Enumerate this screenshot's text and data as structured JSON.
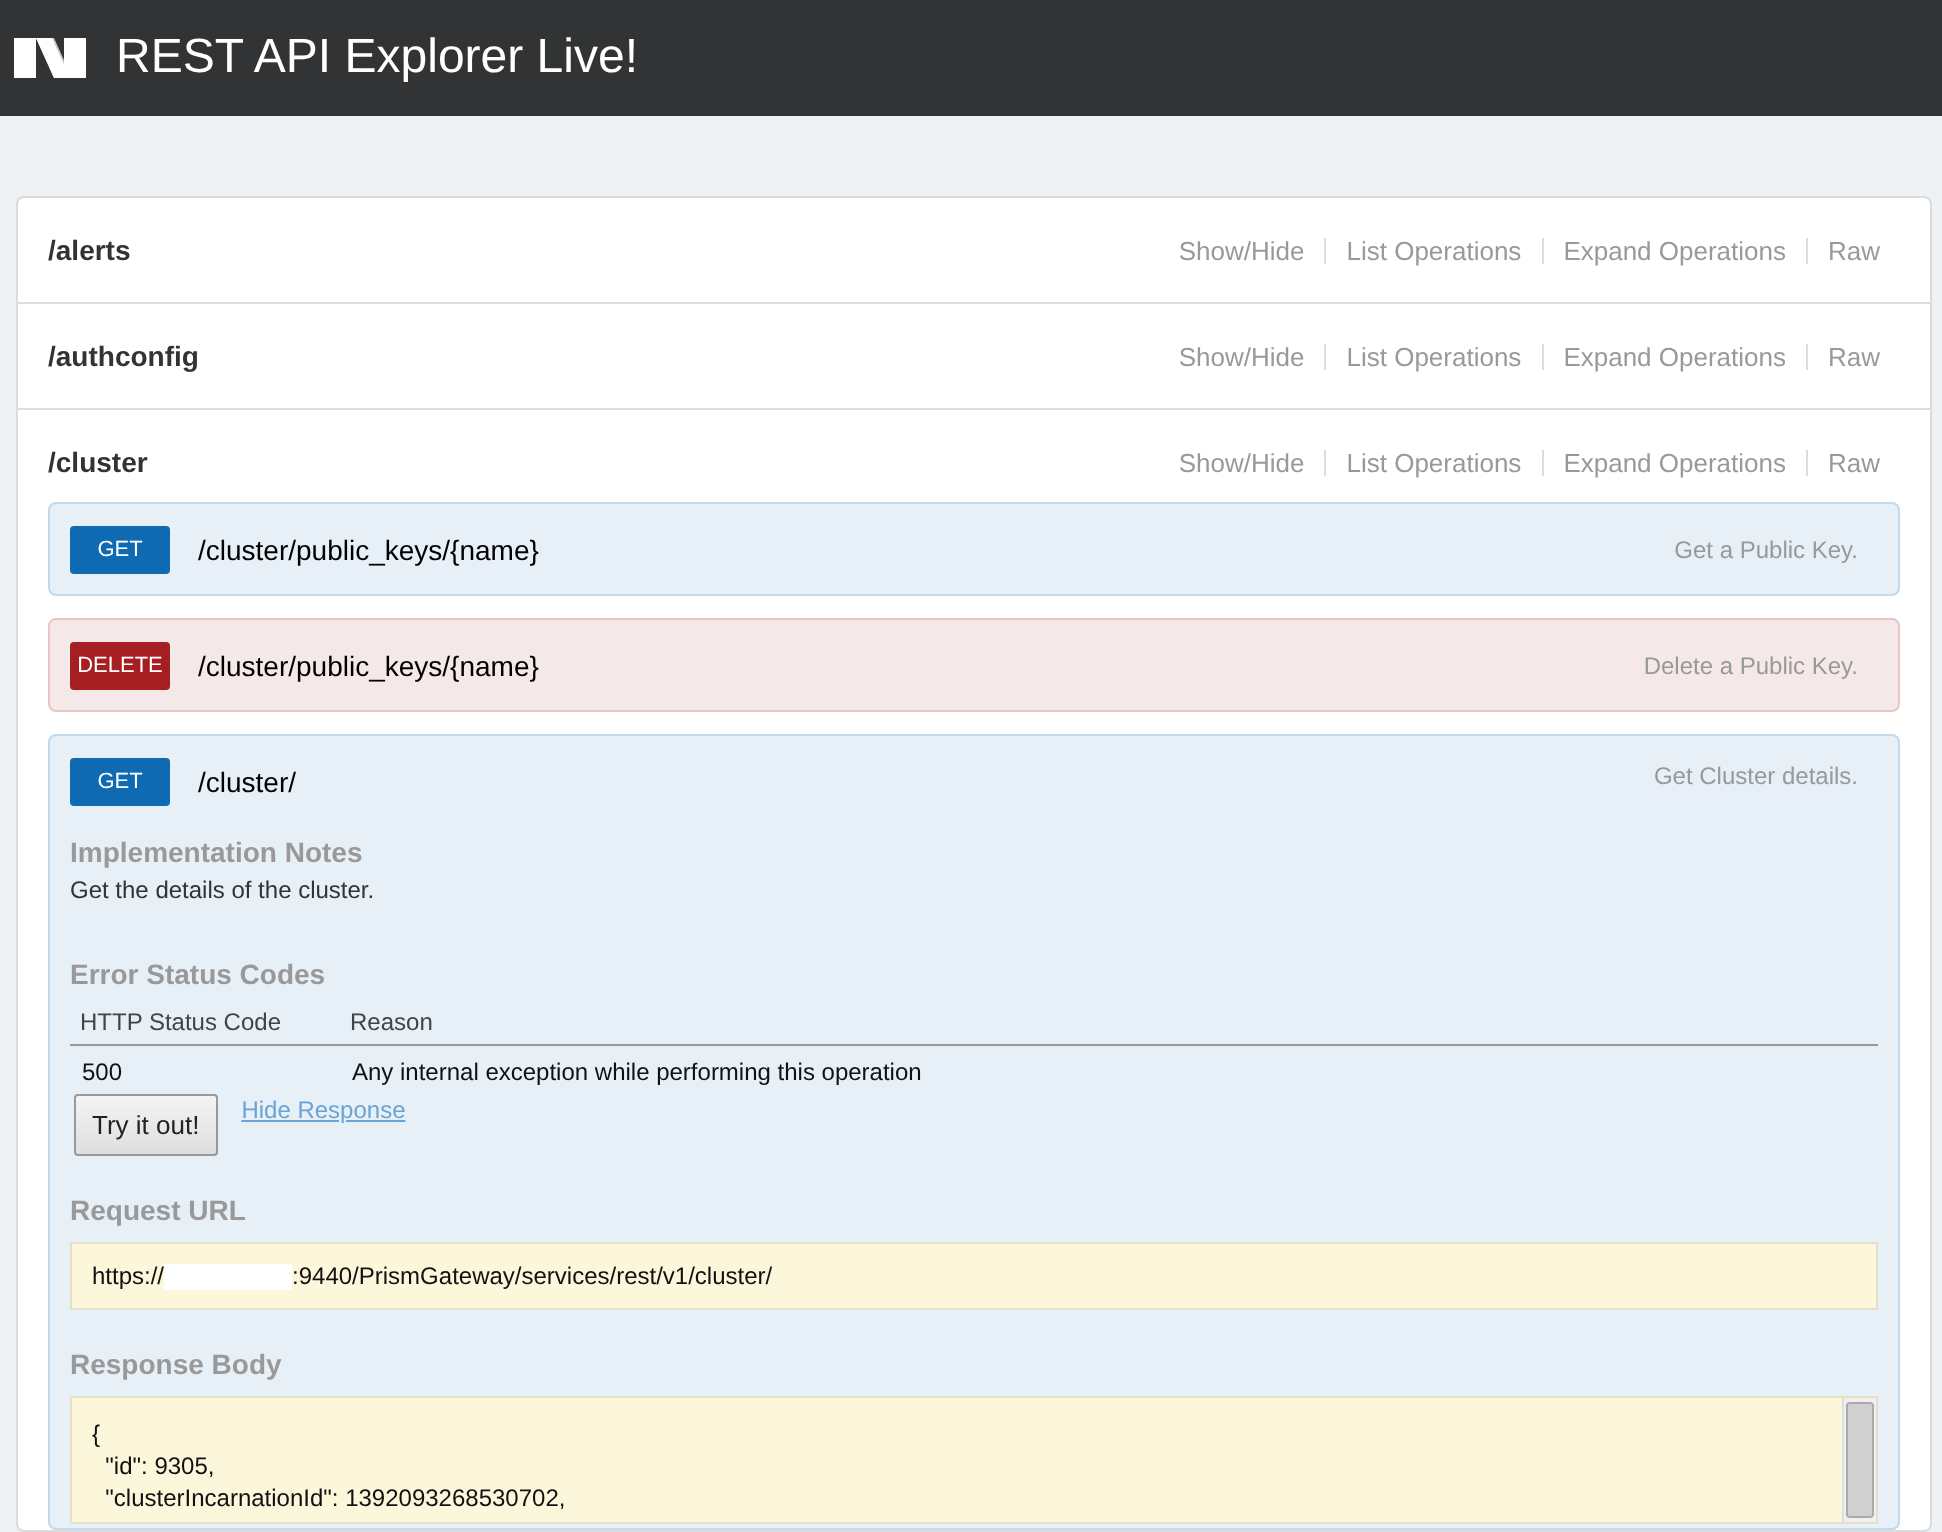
{
  "header": {
    "title": "REST API Explorer Live!"
  },
  "resources": [
    {
      "name": "/alerts",
      "links": [
        "Show/Hide",
        "List Operations",
        "Expand Operations",
        "Raw"
      ]
    },
    {
      "name": "/authconfig",
      "links": [
        "Show/Hide",
        "List Operations",
        "Expand Operations",
        "Raw"
      ]
    },
    {
      "name": "/cluster",
      "links": [
        "Show/Hide",
        "List Operations",
        "Expand Operations",
        "Raw"
      ],
      "operations": [
        {
          "kind": "get",
          "method": "GET",
          "path": "/cluster/public_keys/{name}",
          "summary": "Get a Public Key.",
          "expanded": false
        },
        {
          "kind": "delete",
          "method": "DELETE",
          "path": "/cluster/public_keys/{name}",
          "summary": "Delete a Public Key.",
          "expanded": false
        },
        {
          "kind": "get",
          "method": "GET",
          "path": "/cluster/",
          "summary": "Get Cluster details.",
          "expanded": true,
          "details": {
            "notes_heading": "Implementation Notes",
            "notes_text": "Get the details of the cluster.",
            "errors_heading": "Error Status Codes",
            "error_columns": [
              "HTTP Status Code",
              "Reason"
            ],
            "error_rows": [
              [
                "500",
                "Any internal exception while performing this operation"
              ]
            ],
            "try_button": "Try it out!",
            "hide_link": "Hide Response",
            "url_heading": "Request URL",
            "url_prefix": "https://",
            "url_suffix": ":9440/PrismGateway/services/rest/v1/cluster/",
            "body_heading": "Response Body",
            "body_lines": [
              "{",
              "  \"id\": 9305,",
              "  \"clusterIncarnationId\": 1392093268530702,"
            ]
          }
        }
      ]
    }
  ]
}
